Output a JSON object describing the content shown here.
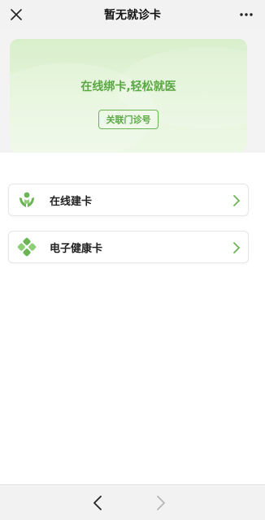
{
  "header": {
    "title": "暂无就诊卡",
    "close_icon": "close-icon",
    "more_icon": "more-icon"
  },
  "hero": {
    "title": "在线绑卡,轻松就医",
    "button_label": "关联门诊号",
    "accent_color": "#5aa843"
  },
  "menu": {
    "items": [
      {
        "label": "在线建卡",
        "icon": "hands-person-icon"
      },
      {
        "label": "电子健康卡",
        "icon": "health-cross-icon"
      }
    ]
  },
  "footer": {
    "back_icon": "chevron-left-icon",
    "forward_icon": "chevron-right-icon"
  }
}
